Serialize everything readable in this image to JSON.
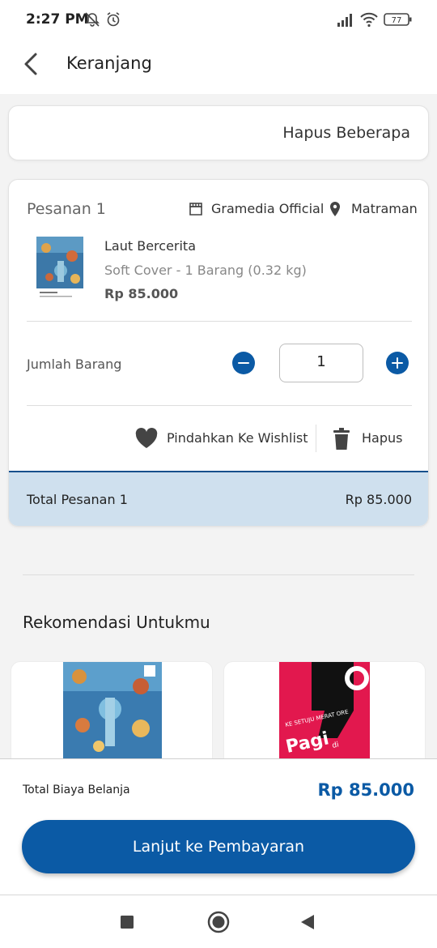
{
  "status_bar": {
    "time": "2:27 PM",
    "battery": "77"
  },
  "app_bar": {
    "title": "Keranjang"
  },
  "actions": {
    "hapus_beberapa": "Hapus Beberapa"
  },
  "order": {
    "title": "Pesanan 1",
    "store": "Gramedia Official",
    "location": "Matraman",
    "item": {
      "title": "Laut Bercerita",
      "variant": "Soft Cover - 1 Barang (0.32 kg)",
      "price": "Rp 85.000"
    },
    "quantity_label": "Jumlah Barang",
    "quantity": "1",
    "wishlist_label": "Pindahkan Ke Wishlist",
    "delete_label": "Hapus",
    "total_label": "Total Pesanan 1",
    "total_value": "Rp 85.000"
  },
  "recommendations": {
    "title": "Rekomendasi Untukmu",
    "items": [
      {
        "cover": "Laut Bercerita cover"
      },
      {
        "cover": "Pagi di Amerika",
        "cover_text_small": "KE SETUJU MERAT ORE",
        "cover_text_big": "Pagi",
        "cover_text_tiny": "di"
      }
    ]
  },
  "checkout": {
    "total_label": "Total Biaya Belanja",
    "total_value": "Rp 85.000",
    "pay_button": "Lanjut ke Pembayaran"
  },
  "colors": {
    "primary": "#0b5aa5",
    "total_bar_bg": "#cfe0ee",
    "page_bg": "#f3f3f3"
  },
  "icons": [
    "back-arrow-icon",
    "store-icon",
    "location-pin-icon",
    "minus-icon",
    "plus-icon",
    "heart-icon",
    "trash-icon",
    "nav-recents-icon",
    "nav-home-icon",
    "nav-back-icon"
  ]
}
